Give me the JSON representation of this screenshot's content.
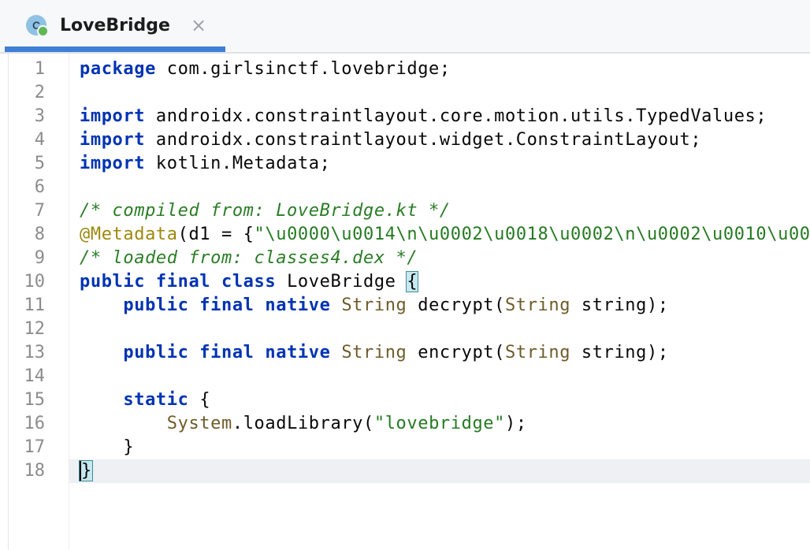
{
  "tab": {
    "icon_letter": "C",
    "title": "LoveBridge",
    "close_glyph": "×"
  },
  "editor": {
    "line_numbers": [
      "1",
      "2",
      "3",
      "4",
      "5",
      "6",
      "7",
      "8",
      "9",
      "10",
      "11",
      "12",
      "13",
      "14",
      "15",
      "16",
      "17",
      "18"
    ],
    "lines": [
      [
        {
          "t": "package",
          "c": "kw"
        },
        {
          "t": " com.girlsinctf.lovebridge;"
        }
      ],
      [],
      [
        {
          "t": "import",
          "c": "kw"
        },
        {
          "t": " androidx.constraintlayout.core.motion.utils.TypedValues;"
        }
      ],
      [
        {
          "t": "import",
          "c": "kw"
        },
        {
          "t": " androidx.constraintlayout.widget.ConstraintLayout;"
        }
      ],
      [
        {
          "t": "import",
          "c": "kw"
        },
        {
          "t": " kotlin.Metadata;"
        }
      ],
      [],
      [
        {
          "t": "/* compiled from: LoveBridge.kt */",
          "c": "cmt"
        }
      ],
      [
        {
          "t": "@Metadata",
          "c": "ann"
        },
        {
          "t": "(d1 = {"
        },
        {
          "t": "\"\\u0000\\u0014\\n\\u0002\\u0018\\u0002\\n\\u0002\\u0010\\u00",
          "c": "str"
        }
      ],
      [
        {
          "t": "/* loaded from: classes4.dex */",
          "c": "cmt"
        }
      ],
      [
        {
          "t": "public final class",
          "c": "kw"
        },
        {
          "t": " LoveBridge "
        },
        {
          "t": "{",
          "c": "brace-hl"
        }
      ],
      [
        {
          "t": "    "
        },
        {
          "t": "public final native",
          "c": "kw"
        },
        {
          "t": " "
        },
        {
          "t": "String",
          "c": "typ"
        },
        {
          "t": " decrypt("
        },
        {
          "t": "String",
          "c": "typ"
        },
        {
          "t": " string);"
        }
      ],
      [],
      [
        {
          "t": "    "
        },
        {
          "t": "public final native",
          "c": "kw"
        },
        {
          "t": " "
        },
        {
          "t": "String",
          "c": "typ"
        },
        {
          "t": " encrypt("
        },
        {
          "t": "String",
          "c": "typ"
        },
        {
          "t": " string);"
        }
      ],
      [],
      [
        {
          "t": "    "
        },
        {
          "t": "static",
          "c": "kw"
        },
        {
          "t": " {"
        }
      ],
      [
        {
          "t": "        "
        },
        {
          "t": "System",
          "c": "typ"
        },
        {
          "t": ".loadLibrary("
        },
        {
          "t": "\"lovebridge\"",
          "c": "str"
        },
        {
          "t": ");"
        }
      ],
      [
        {
          "t": "    }"
        }
      ],
      [
        {
          "t": "}",
          "c": "brace-hl caret"
        }
      ]
    ]
  },
  "colors": {
    "keyword": "#0033b3",
    "type": "#6f5b2a",
    "string": "#257a21",
    "comment": "#2a7d25",
    "annotation": "#9e880d",
    "tab_accent": "#3f7fd6"
  },
  "icons": {
    "tab_icon": "java-class-icon",
    "close": "close-icon"
  }
}
